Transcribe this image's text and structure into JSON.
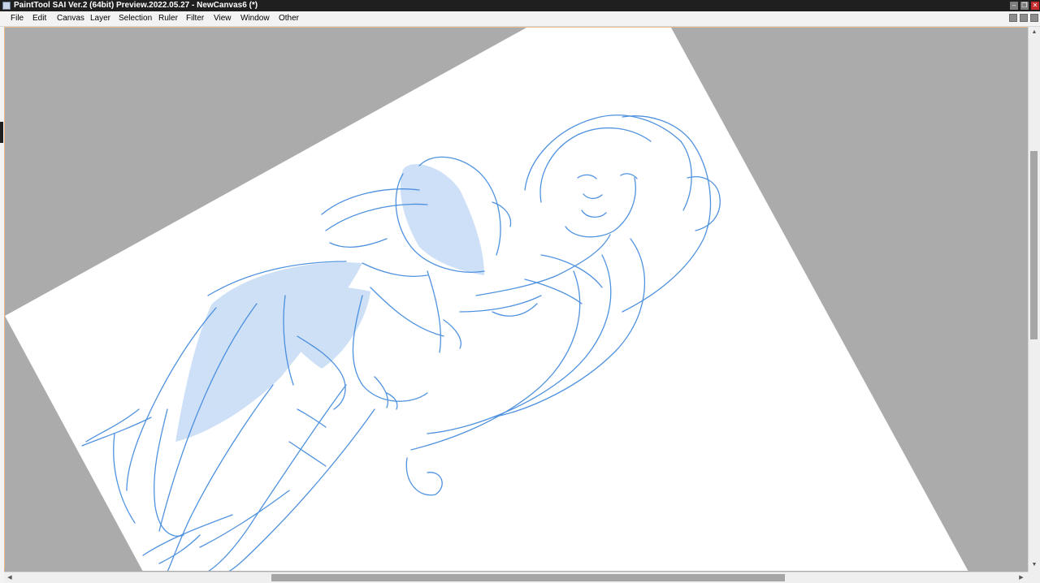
{
  "window": {
    "title": "PaintTool SAI Ver.2 (64bit) Preview.2022.05.27 - NewCanvas6 (*)",
    "minimize_icon": "minimize-icon",
    "maximize_icon": "restore-icon",
    "close_icon": "close-icon",
    "close_color": "#c42b2b"
  },
  "menu": {
    "file": "File",
    "edit": "Edit",
    "canvas": "Canvas",
    "layer": "Layer",
    "selection": "Selection",
    "ruler": "Ruler",
    "filter": "Filter",
    "view": "View",
    "window": "Window",
    "other": "Other"
  },
  "canvas": {
    "background_color": "#ababab",
    "paper_color": "#ffffff",
    "sketch_color": "#3d87dd",
    "sketch_fill_color": "#b9d3f3"
  },
  "scrollbars": {
    "vertical_position": 0.36,
    "horizontal_position": 0.41
  }
}
